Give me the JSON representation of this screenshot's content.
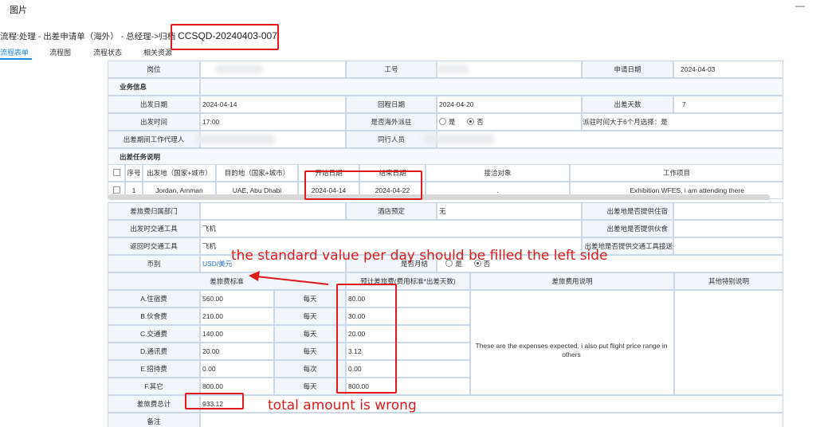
{
  "window": {
    "title": "图片",
    "minimize": "—"
  },
  "flow": {
    "title": "流程:处理 - 出差申请单（海外） - 总经理->归档",
    "code": "CCSQD-20240403-007"
  },
  "tabs": [
    "流程表单",
    "流程图",
    "流程状态",
    "相关资源"
  ],
  "header_row": {
    "position_label": "岗位",
    "id_label": "工号",
    "apply_date_label": "申请日期",
    "apply_date": "2024-04-03"
  },
  "section_business": "业务信息",
  "trip": {
    "depart_date_label": "出发日期",
    "depart_date": "2024-04-14",
    "return_date_label": "回程日期",
    "return_date": "2024-04-20",
    "days_label": "出差天数",
    "days": "7",
    "depart_time_label": "出发时间",
    "depart_time": "17:00",
    "overseas_label": "是否海外派驻",
    "yes": "是",
    "no": "否",
    "over6_text": "派驻时间大于6个月选择：是",
    "agent_label": "出差期间工作代理人",
    "companion_label": "同行人员"
  },
  "section_task": "出差任务说明",
  "task_table": {
    "headers": [
      "序号",
      "出发地（国家+城市）",
      "目的地（国家+城市）",
      "开始日期",
      "结束日期",
      "接洽对象",
      "工作项目"
    ],
    "rows": [
      [
        "1",
        "Jordan, Amman",
        "UAE, Abu Dhabi",
        "2024-04-14",
        "2024-04-22",
        ".",
        "Exhibition WFES, i am attending there"
      ]
    ]
  },
  "expense_info": {
    "dept_label": "差旅费归属部门",
    "hotel_label": "酒店预定",
    "hotel_value": "无",
    "lodging_label": "出差地是否提供住宿",
    "go_transport_label": "出发时交通工具",
    "go_transport": "飞机",
    "food_label": "出差地是否提供伙食",
    "back_transport_label": "返回时交通工具",
    "back_transport": "飞机",
    "transport_provided_label": "出差地是否提供交通工具接送",
    "currency_label": "币别",
    "currency": "USD/美元",
    "monthly_label": "是否月结",
    "yes": "是",
    "no": "否"
  },
  "expense_table": {
    "standard_header": "差旅费标准",
    "estimate_header": "预计差旅费(费用标准*出差天数)",
    "explain_header": "差旅费用说明",
    "other_header": "其他特别说明",
    "rows": [
      {
        "name": "A.住宿费",
        "standard": "560.00",
        "unit": "每天",
        "estimate": "80.00"
      },
      {
        "name": "B.伙食费",
        "standard": "210.00",
        "unit": "每天",
        "estimate": "30.00"
      },
      {
        "name": "C.交通费",
        "standard": "140.00",
        "unit": "每天",
        "estimate": "20.00"
      },
      {
        "name": "D.通讯费",
        "standard": "20.00",
        "unit": "每天",
        "estimate": "3.12"
      },
      {
        "name": "E.招待费",
        "standard": "0.00",
        "unit": "每次",
        "estimate": "0.00"
      },
      {
        "name": "F.其它",
        "standard": "800.00",
        "unit": "每天",
        "estimate": "800.00"
      }
    ],
    "explain_text": "These are the expenses expected, i also put flight price range in others",
    "total_label": "差旅费总计",
    "total": "933.12",
    "remark_label": "备注"
  },
  "annotations": {
    "note1": "the standard  value per day should be filled the left side",
    "note2": "total amount is wrong",
    "color": "#e0191a"
  }
}
